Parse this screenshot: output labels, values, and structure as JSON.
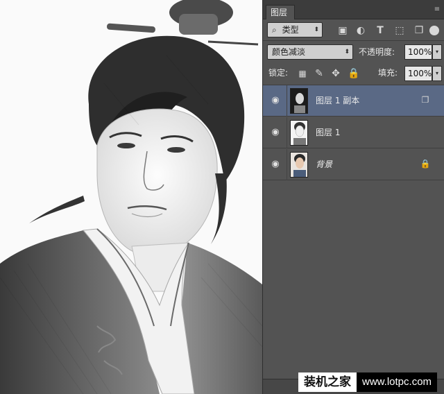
{
  "panel": {
    "tab_label": "图层",
    "menu_icon": "panel-menu-icon",
    "filter": {
      "label": "类型",
      "icon": "search-icon"
    },
    "filter_icons": [
      "image-filter-icon",
      "adjustment-filter-icon",
      "type-filter-icon",
      "shape-filter-icon",
      "smart-object-filter-icon"
    ],
    "blend_mode": "颜色减淡",
    "opacity_label": "不透明度:",
    "opacity_value": "100%",
    "lock_label": "锁定:",
    "lock_icons": [
      "lock-transparent-icon",
      "lock-paint-icon",
      "lock-move-icon",
      "lock-all-icon"
    ],
    "fill_label": "填充:",
    "fill_value": "100%"
  },
  "layers": [
    {
      "name": "图层 1 副本",
      "selected": true,
      "badge": "smart-object-icon"
    },
    {
      "name": "图层 1",
      "selected": false,
      "badge": ""
    },
    {
      "name": "背景",
      "selected": false,
      "badge": "lock-icon"
    }
  ],
  "watermark": {
    "cn": "装机之家",
    "url": "www.lotpc.com"
  },
  "colors": {
    "panel_bg": "#535353",
    "selected_layer": "#5a6985",
    "tab_bar": "#3c3c3c"
  }
}
